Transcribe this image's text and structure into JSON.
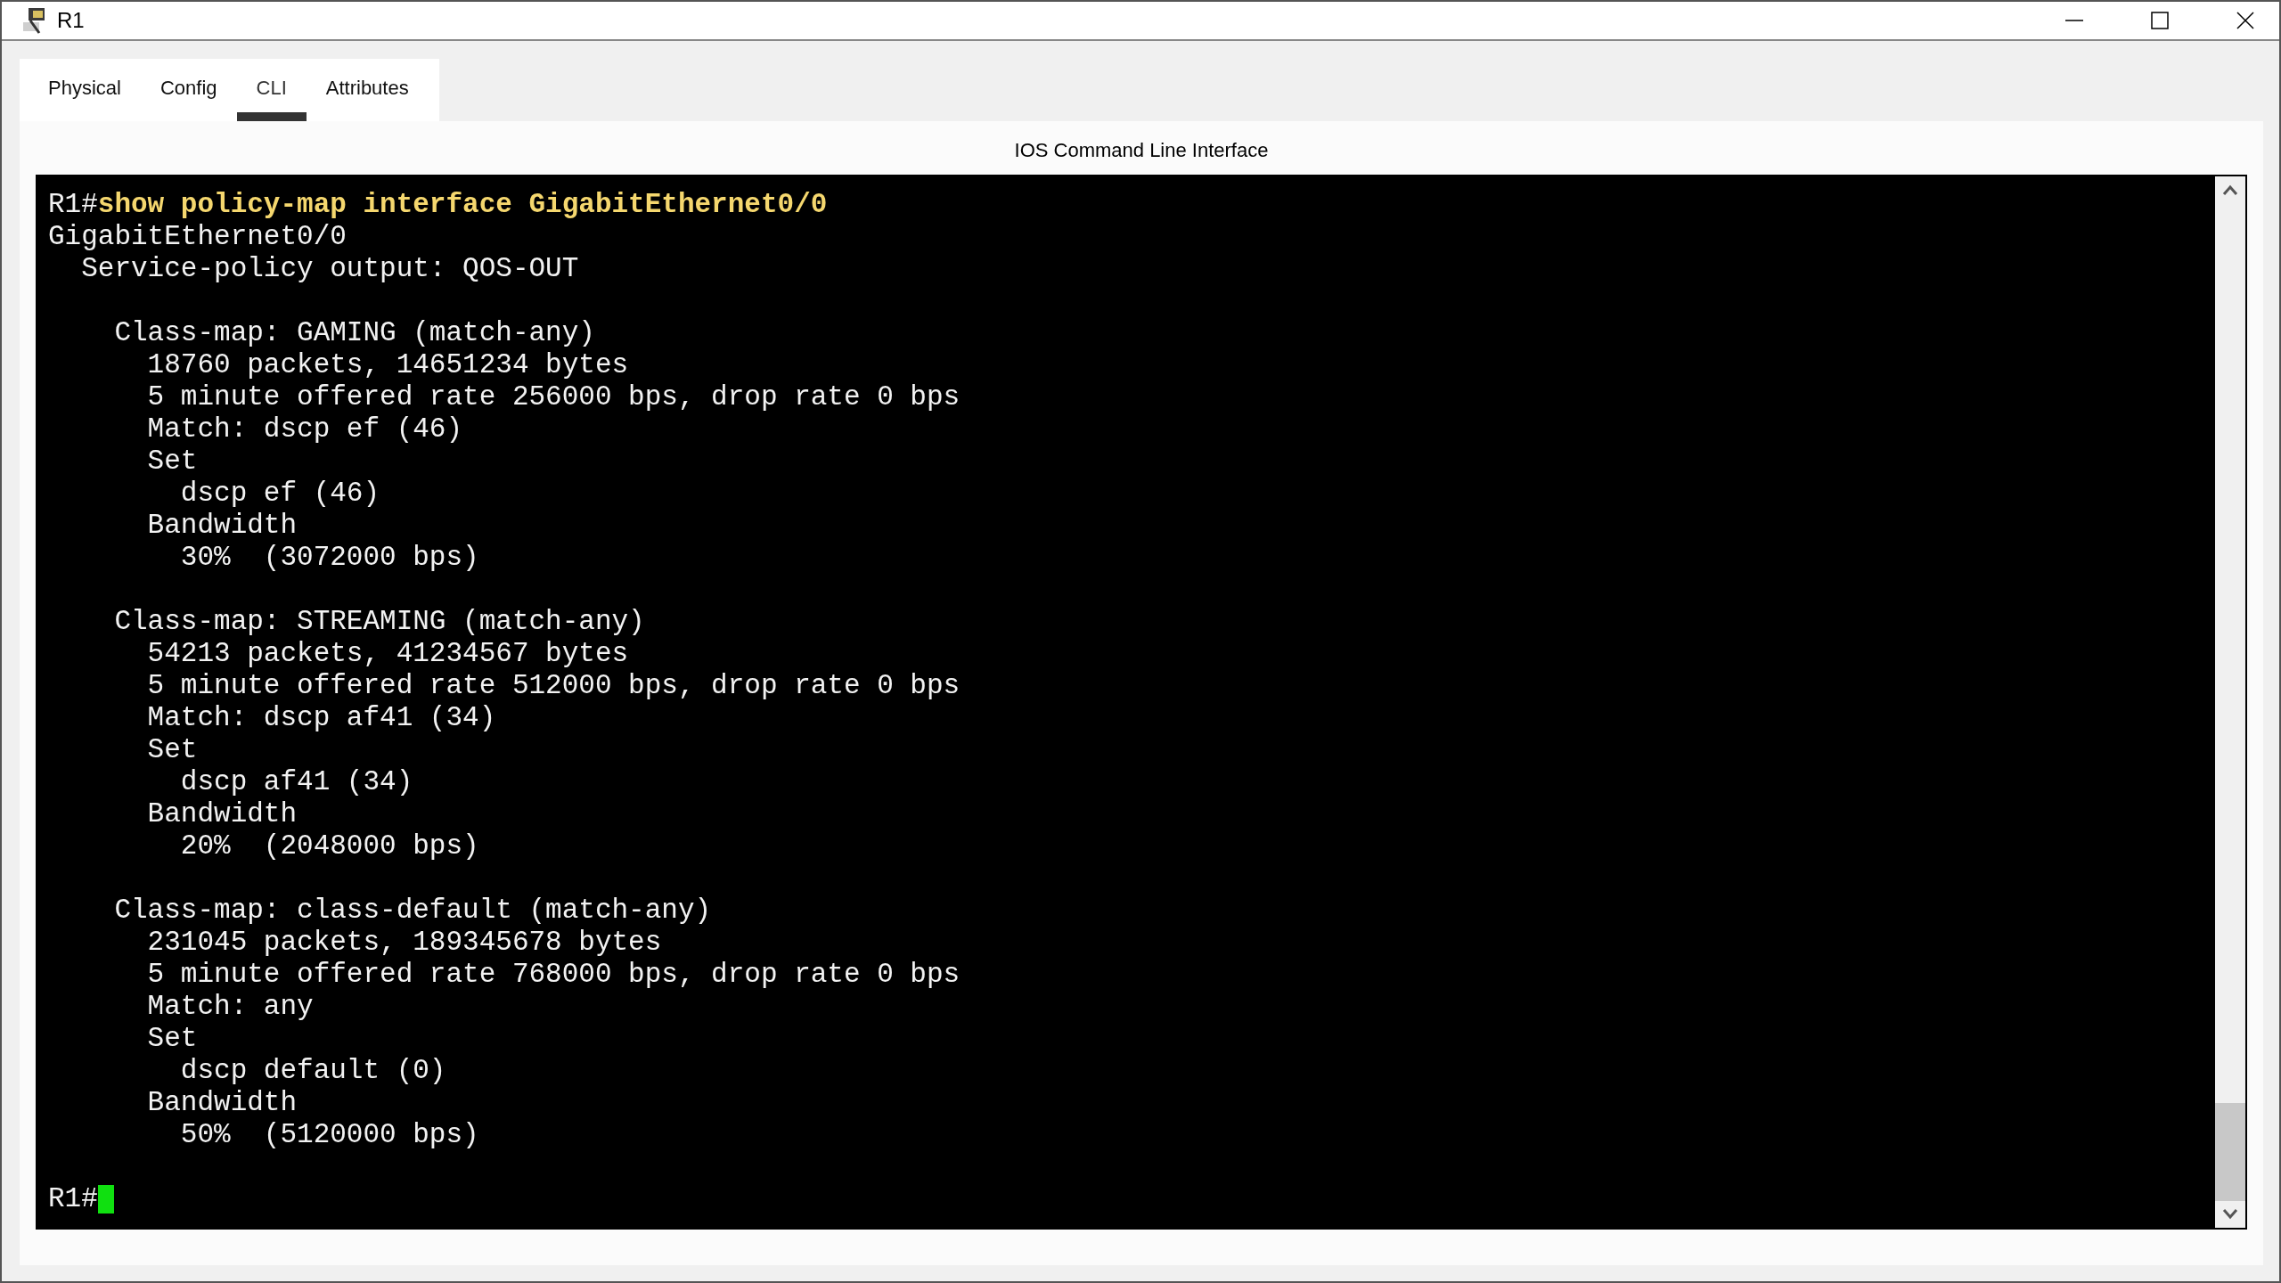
{
  "window": {
    "title": "R1"
  },
  "tabs": [
    {
      "label": "Physical",
      "selected": false
    },
    {
      "label": "Config",
      "selected": false
    },
    {
      "label": "CLI",
      "selected": true
    },
    {
      "label": "Attributes",
      "selected": false
    }
  ],
  "panel_title": "IOS Command Line Interface",
  "terminal": {
    "blocks": [
      {
        "lines": [
          {
            "kind": "command",
            "prompt": "R1#",
            "command": "show policy-map interface GigabitEthernet0/0"
          },
          {
            "kind": "output",
            "text": "GigabitEthernet0/0"
          },
          {
            "kind": "output",
            "text": "  Service-policy output: QOS-OUT"
          }
        ]
      },
      {
        "lines": [
          {
            "kind": "output",
            "text": "    Class-map: GAMING (match-any)"
          },
          {
            "kind": "output",
            "text": "      18760 packets, 14651234 bytes"
          },
          {
            "kind": "output",
            "text": "      5 minute offered rate 256000 bps, drop rate 0 bps"
          },
          {
            "kind": "output",
            "text": "      Match: dscp ef (46)"
          },
          {
            "kind": "output",
            "text": "      Set"
          },
          {
            "kind": "output",
            "text": "        dscp ef (46)"
          },
          {
            "kind": "output",
            "text": "      Bandwidth"
          },
          {
            "kind": "output",
            "text": "        30%  (3072000 bps)"
          }
        ]
      },
      {
        "lines": [
          {
            "kind": "output",
            "text": "    Class-map: STREAMING (match-any)"
          },
          {
            "kind": "output",
            "text": "      54213 packets, 41234567 bytes"
          },
          {
            "kind": "output",
            "text": "      5 minute offered rate 512000 bps, drop rate 0 bps"
          },
          {
            "kind": "output",
            "text": "      Match: dscp af41 (34)"
          },
          {
            "kind": "output",
            "text": "      Set"
          },
          {
            "kind": "output",
            "text": "        dscp af41 (34)"
          },
          {
            "kind": "output",
            "text": "      Bandwidth"
          },
          {
            "kind": "output",
            "text": "        20%  (2048000 bps)"
          }
        ]
      },
      {
        "lines": [
          {
            "kind": "output",
            "text": "    Class-map: class-default (match-any)"
          },
          {
            "kind": "output",
            "text": "      231045 packets, 189345678 bytes"
          },
          {
            "kind": "output",
            "text": "      5 minute offered rate 768000 bps, drop rate 0 bps"
          },
          {
            "kind": "output",
            "text": "      Match: any"
          },
          {
            "kind": "output",
            "text": "      Set"
          },
          {
            "kind": "output",
            "text": "        dscp default (0)"
          },
          {
            "kind": "output",
            "text": "      Bandwidth"
          },
          {
            "kind": "output",
            "text": "        50%  (5120000 bps)"
          }
        ]
      }
    ],
    "prompt": {
      "text": "R1#",
      "cursor": true
    }
  }
}
